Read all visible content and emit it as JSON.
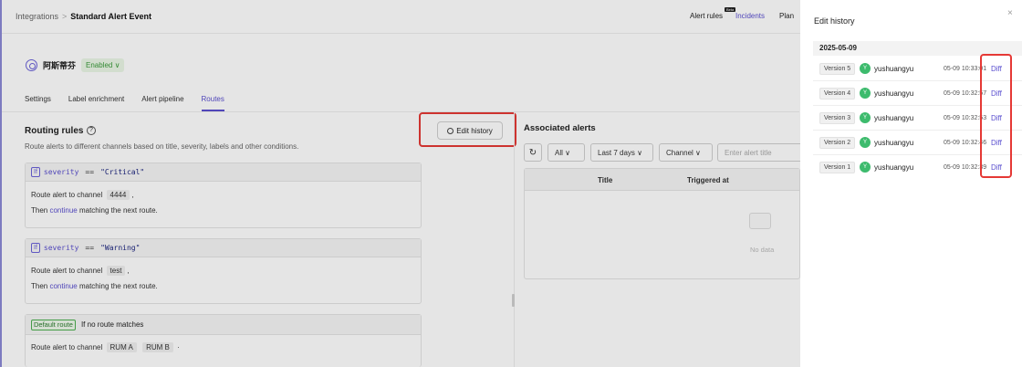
{
  "header": {
    "breadcrumb_root": "Integrations",
    "breadcrumb_sep": ">",
    "breadcrumb_current": "Standard Alert Event",
    "nav": [
      {
        "label": "Alert rules",
        "badge": "Beta"
      },
      {
        "label": "Incidents"
      },
      {
        "label": "Plan"
      }
    ]
  },
  "integration": {
    "name": "阿斯蒂芬",
    "status": "Enabled ∨"
  },
  "tabs": [
    "Settings",
    "Label enrichment",
    "Alert pipeline",
    "Routes"
  ],
  "active_tab": "Routes",
  "routing": {
    "title": "Routing rules",
    "help": "?",
    "description": "Route alerts to different channels based on title, severity, labels and other conditions.",
    "edit_history_label": "Edit history",
    "rules": [
      {
        "if_label": "If",
        "field": "severity",
        "operator": "==",
        "value": "\"Critical\"",
        "line1_prefix": "Route alert to channel",
        "channels": [
          "4444"
        ],
        "line1_suffix": ",",
        "line2_prefix": "Then",
        "line2_link": "continue",
        "line2_suffix": "matching the next route."
      },
      {
        "if_label": "If",
        "field": "severity",
        "operator": "==",
        "value": "\"Warning\"",
        "line1_prefix": "Route alert to channel",
        "channels": [
          "test"
        ],
        "line1_suffix": ",",
        "line2_prefix": "Then",
        "line2_link": "continue",
        "line2_suffix": "matching the next route."
      }
    ],
    "default_route": {
      "tag": "Default route",
      "condition": "If no route matches",
      "line1_prefix": "Route alert to channel",
      "channels": [
        "RUM A",
        "RUM B"
      ],
      "line1_suffix": "·"
    }
  },
  "associated": {
    "title": "Associated alerts",
    "filters": [
      "All ∨",
      "Last 7 days ∨",
      "Channel ∨"
    ],
    "search_placeholder": "Enter alert title",
    "columns": [
      "Title",
      "Triggered at"
    ],
    "empty_text": "No data"
  },
  "drawer": {
    "title": "Edit history",
    "close": "×",
    "date": "2025-05-09",
    "versions": [
      {
        "label": "Version 5",
        "user": "yushuangyu",
        "time": "05-09 10:33:01",
        "diff": "Diff"
      },
      {
        "label": "Version 4",
        "user": "yushuangyu",
        "time": "05-09 10:32:57",
        "diff": "Diff"
      },
      {
        "label": "Version 3",
        "user": "yushuangyu",
        "time": "05-09 10:32:53",
        "diff": "Diff"
      },
      {
        "label": "Version 2",
        "user": "yushuangyu",
        "time": "05-09 10:32:46",
        "diff": "Diff"
      },
      {
        "label": "Version 1",
        "user": "yushuangyu",
        "time": "05-09 10:32:39",
        "diff": "Diff"
      }
    ],
    "avatar_initial": "Y"
  },
  "colors": {
    "accent": "#5a4fcf",
    "highlight": "#e53935",
    "enabled": "#3a9a3a",
    "avatar": "#3dbb6d"
  }
}
